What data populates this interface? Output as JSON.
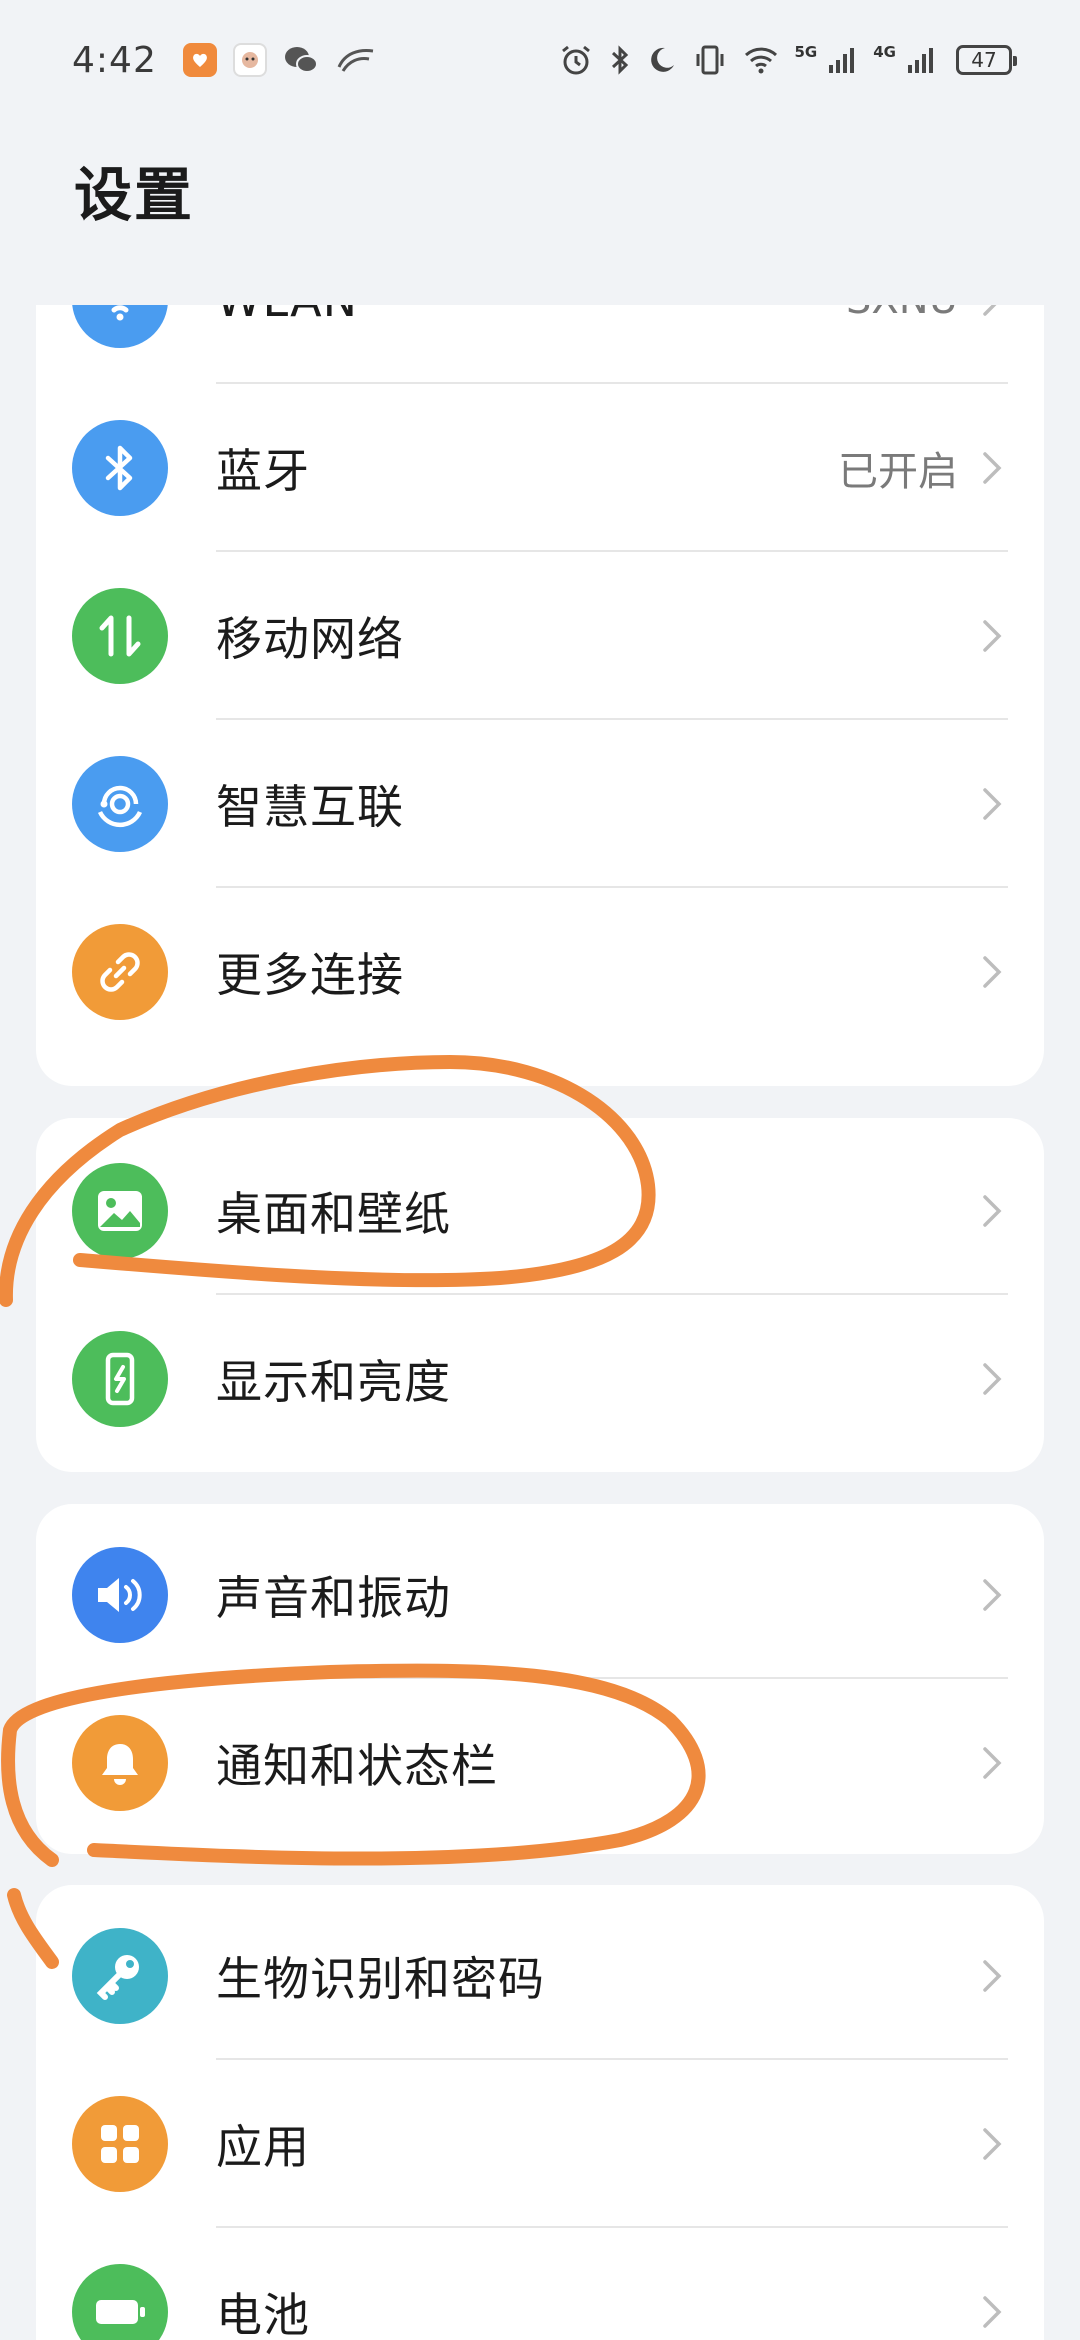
{
  "status_bar": {
    "time": "4:42",
    "net1": "5G",
    "net2": "4G",
    "battery": "47"
  },
  "page": {
    "title": "设置"
  },
  "groups": [
    {
      "items": [
        {
          "label": "WLAN",
          "value": "SXNU",
          "icon": "wifi-icon",
          "color": "#4a9cf0"
        },
        {
          "label": "蓝牙",
          "value": "已开启",
          "icon": "bluetooth-icon",
          "color": "#4a9cf0"
        },
        {
          "label": "移动网络",
          "value": "",
          "icon": "mobile-data-icon",
          "color": "#4dbd5b"
        },
        {
          "label": "智慧互联",
          "value": "",
          "icon": "smart-connect-icon",
          "color": "#4a9cf0"
        },
        {
          "label": "更多连接",
          "value": "",
          "icon": "link-icon",
          "color": "#f19b38"
        }
      ]
    },
    {
      "items": [
        {
          "label": "桌面和壁纸",
          "value": "",
          "icon": "wallpaper-icon",
          "color": "#4dbd5b"
        },
        {
          "label": "显示和亮度",
          "value": "",
          "icon": "display-icon",
          "color": "#4dbd5b"
        }
      ]
    },
    {
      "items": [
        {
          "label": "声音和振动",
          "value": "",
          "icon": "sound-icon",
          "color": "#3f84ee"
        },
        {
          "label": "通知和状态栏",
          "value": "",
          "icon": "bell-icon",
          "color": "#f19b38"
        }
      ]
    },
    {
      "items": [
        {
          "label": "生物识别和密码",
          "value": "",
          "icon": "key-icon",
          "color": "#3fb3c8"
        },
        {
          "label": "应用",
          "value": "",
          "icon": "apps-icon",
          "color": "#f19b38"
        },
        {
          "label": "电池",
          "value": "",
          "icon": "battery-icon",
          "color": "#4dbd5b"
        }
      ]
    }
  ],
  "annotation_color": "#ef8a3e"
}
